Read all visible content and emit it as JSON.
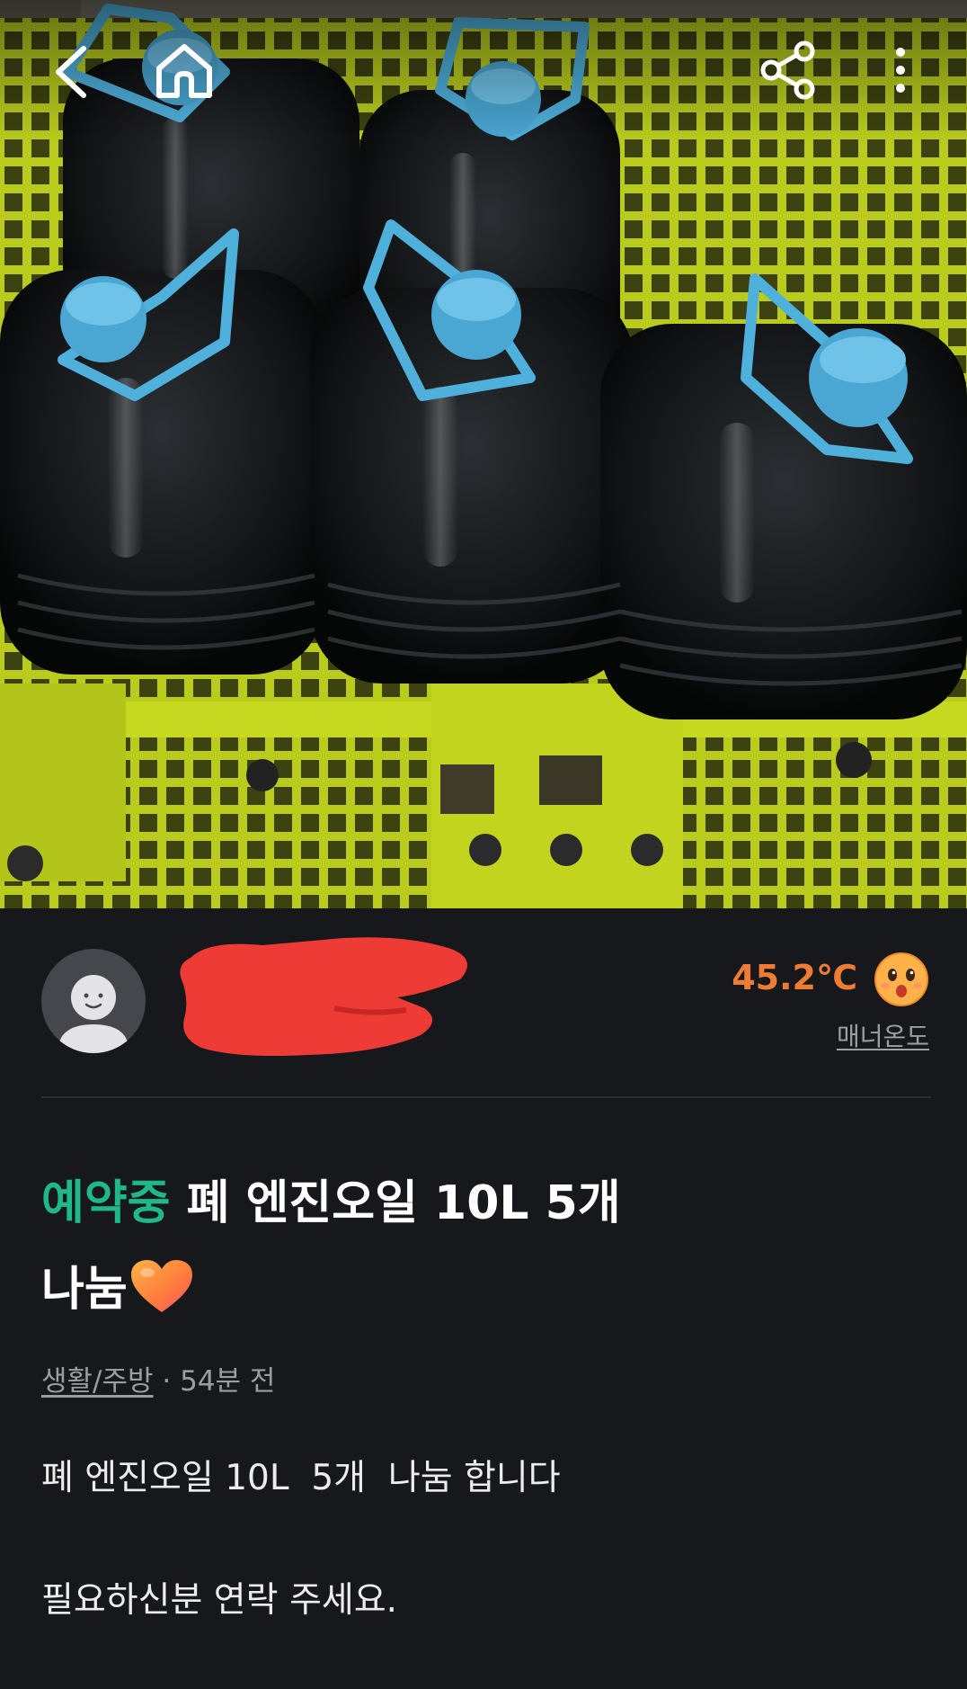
{
  "topbar": {
    "back": "back-arrow-icon",
    "home": "home-icon",
    "share": "share-icon",
    "more": "more-vertical-icon"
  },
  "seller": {
    "name": "",
    "location": "",
    "manner_temp": "45.2℃",
    "manner_label": "매너온도",
    "temp_color": "#ef7c35"
  },
  "post": {
    "status": "예약중",
    "status_color": "#1fb88a",
    "title_line1": "폐 엔진오일 10L 5개",
    "title_line2": "나눔",
    "category": "생활/주방",
    "time_ago": "54분 전",
    "separator": " · ",
    "body_line1": "폐 엔진오일 10L  5개  나눔 합니다",
    "body_line2": "필요하신분 연락 주세요."
  }
}
